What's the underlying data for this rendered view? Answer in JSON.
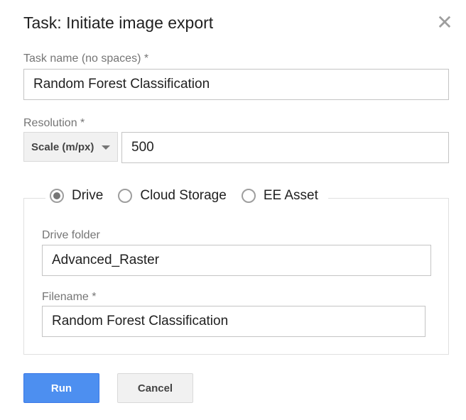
{
  "dialog": {
    "title": "Task: Initiate image export",
    "close_icon": "close-icon"
  },
  "task_name": {
    "label": "Task name (no spaces) *",
    "value": "Random Forest Classification"
  },
  "resolution": {
    "label": "Resolution *",
    "mode": "Scale (m/px)",
    "value": "500"
  },
  "destination": {
    "options": [
      {
        "label": "Drive",
        "selected": true
      },
      {
        "label": "Cloud Storage",
        "selected": false
      },
      {
        "label": "EE Asset",
        "selected": false
      }
    ],
    "drive_folder": {
      "label": "Drive folder",
      "value": "Advanced_Raster"
    },
    "filename": {
      "label": "Filename *",
      "value": "Random Forest Classification"
    }
  },
  "actions": {
    "run_label": "Run",
    "cancel_label": "Cancel"
  },
  "colors": {
    "run_button": "#4d8ff0",
    "label_text": "#757575",
    "border": "#c4c4c4"
  }
}
